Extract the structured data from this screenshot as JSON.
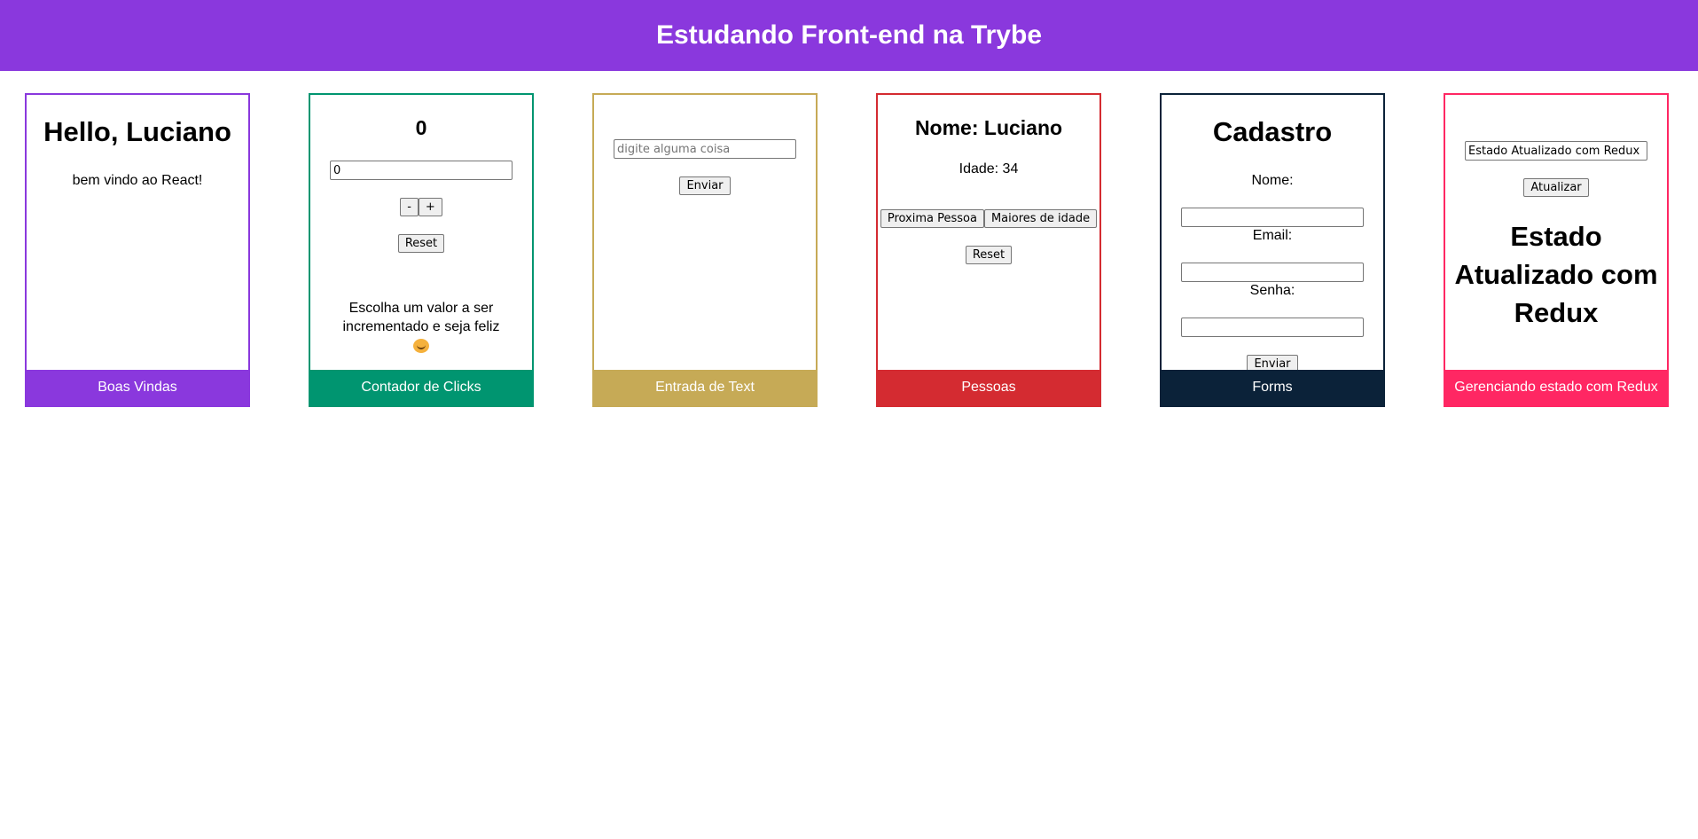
{
  "header": {
    "title": "Estudando Front-end na Trybe"
  },
  "cards": {
    "boas_vindas": {
      "heading": "Hello, Luciano",
      "text": "bem vindo ao React!",
      "footer": "Boas Vindas",
      "color": "#8a38dd"
    },
    "contador": {
      "count": "0",
      "input_value": "0",
      "minus_label": "-",
      "plus_label": "+",
      "reset_label": "Reset",
      "message": "Escolha um valor a ser incrementado e seja feliz",
      "emoji": "hugging-face-icon",
      "footer": "Contador de Clicks",
      "color": "#009570"
    },
    "entrada_texto": {
      "placeholder": "digite alguma coisa",
      "send_label": "Enviar",
      "footer": "Entrada de Text",
      "color": "#c6aa56"
    },
    "pessoas": {
      "name": "Nome: Luciano",
      "age": "Idade: 34",
      "next_label": "Proxima Pessoa",
      "adults_label": "Maiores de idade",
      "reset_label": "Reset",
      "footer": "Pessoas",
      "color": "#d42b31"
    },
    "forms": {
      "heading": "Cadastro",
      "name_label": "Nome:",
      "email_label": "Email:",
      "password_label": "Senha:",
      "submit_label": "Enviar",
      "footer": "Forms",
      "color": "#0b2239"
    },
    "redux": {
      "input_value": "Estado Atualizado com Redux",
      "update_label": "Atualizar",
      "state_text": "Estado Atualizado com Redux",
      "footer": "Gerenciando estado com Redux",
      "color": "#ff2763"
    }
  }
}
